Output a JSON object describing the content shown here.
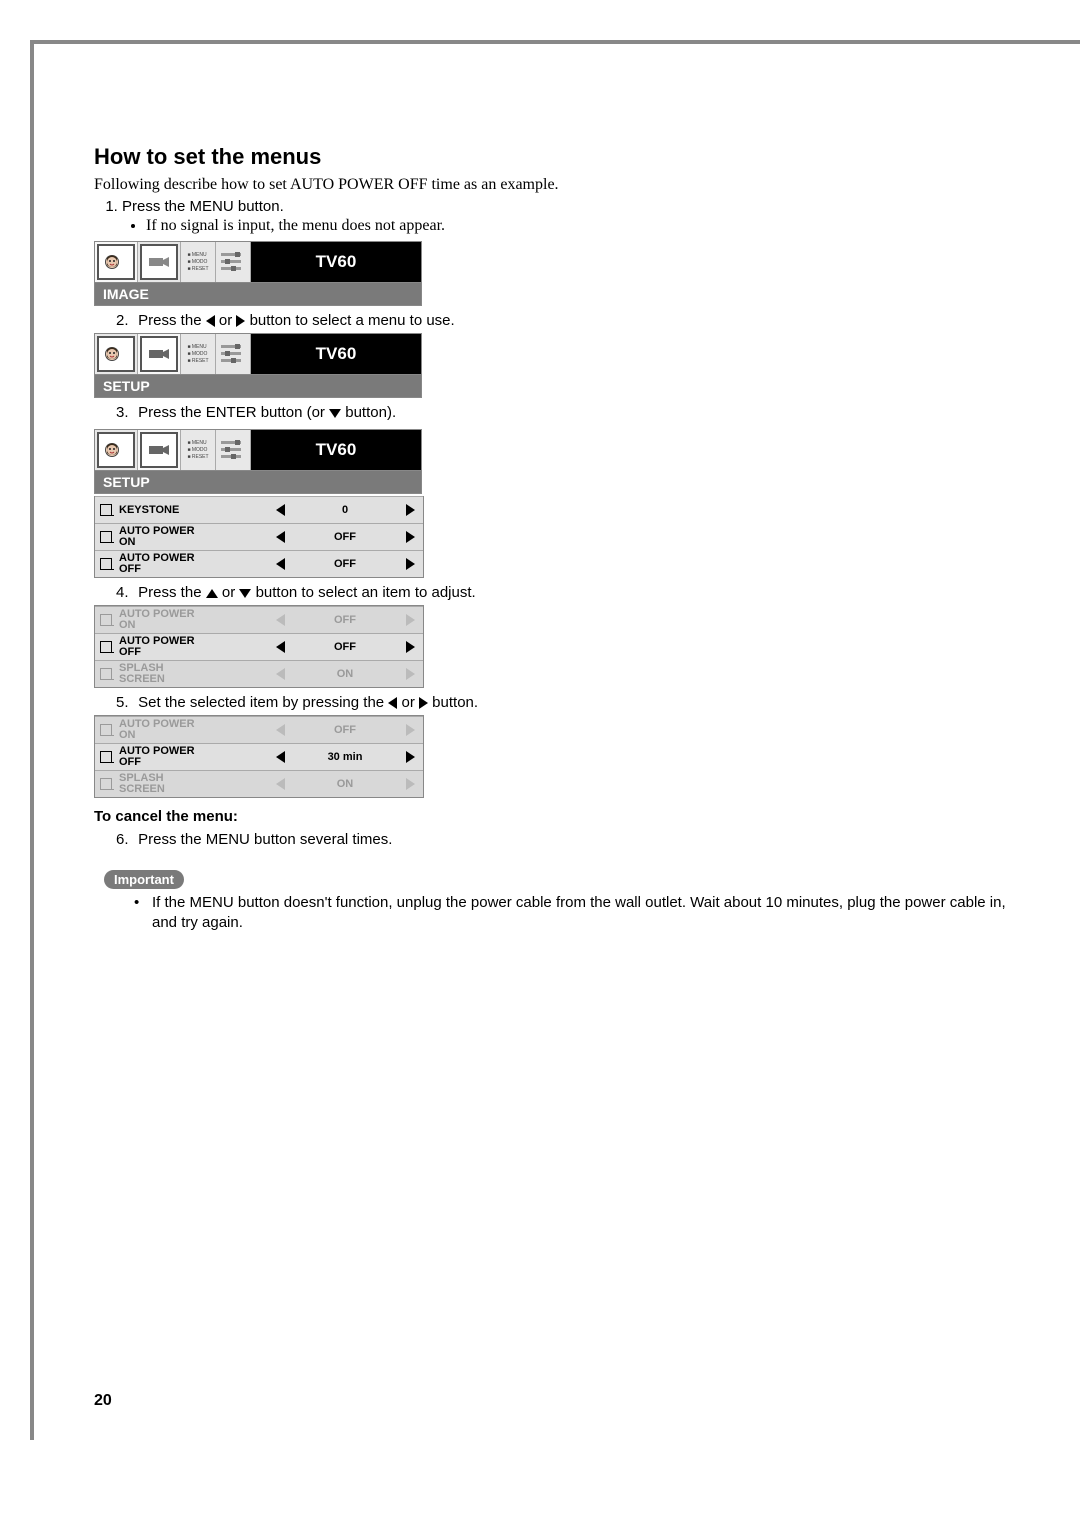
{
  "title": "How to set the menus",
  "intro": "Following describe how to set AUTO POWER OFF time as an example.",
  "step1": "Press the MENU button.",
  "step1_note": "If no signal is input, the menu does not appear.",
  "tv_label": "TV60",
  "menu1_name": "IMAGE",
  "step2_a": "Press the ",
  "step2_b": " or ",
  "step2_c": " button to select a menu to use.",
  "menu2_name": "SETUP",
  "step3_a": "Press the ENTER button (or ",
  "step3_b": " button).",
  "menu3_name": "SETUP",
  "setup_rows": [
    {
      "label": "KEYSTONE",
      "value": "0"
    },
    {
      "label": "AUTO POWER\nON",
      "value": "OFF"
    },
    {
      "label": "AUTO POWER\nOFF",
      "value": "OFF"
    }
  ],
  "step4_a": "Press the ",
  "step4_b": " or ",
  "step4_c": " button to select an item to adjust.",
  "select_rows": [
    {
      "label": "AUTO POWER\nON",
      "value": "OFF",
      "dim": true
    },
    {
      "label": "AUTO POWER\nOFF",
      "value": "OFF",
      "dim": false
    },
    {
      "label": "SPLASH\nSCREEN",
      "value": "ON",
      "dim": true
    }
  ],
  "step5_a": "Set the selected item by pressing the ",
  "step5_b": " or ",
  "step5_c": " button.",
  "set_rows": [
    {
      "label": "AUTO POWER\nON",
      "value": "OFF",
      "dim": true
    },
    {
      "label": "AUTO POWER\nOFF",
      "value": "30 min",
      "dim": false
    },
    {
      "label": "SPLASH\nSCREEN",
      "value": "ON",
      "dim": true
    }
  ],
  "cancel_heading": "To cancel the menu:",
  "step6": "Press the MENU button several times.",
  "important_label": "Important",
  "important_text": "If the MENU button doesn't function, unplug the power cable from the wall outlet. Wait about 10 minutes, plug the power cable in, and try again.",
  "page_number": "20",
  "icon_labels": {
    "menu": "MENU",
    "mode": "MODO",
    "reset": "RESET"
  }
}
